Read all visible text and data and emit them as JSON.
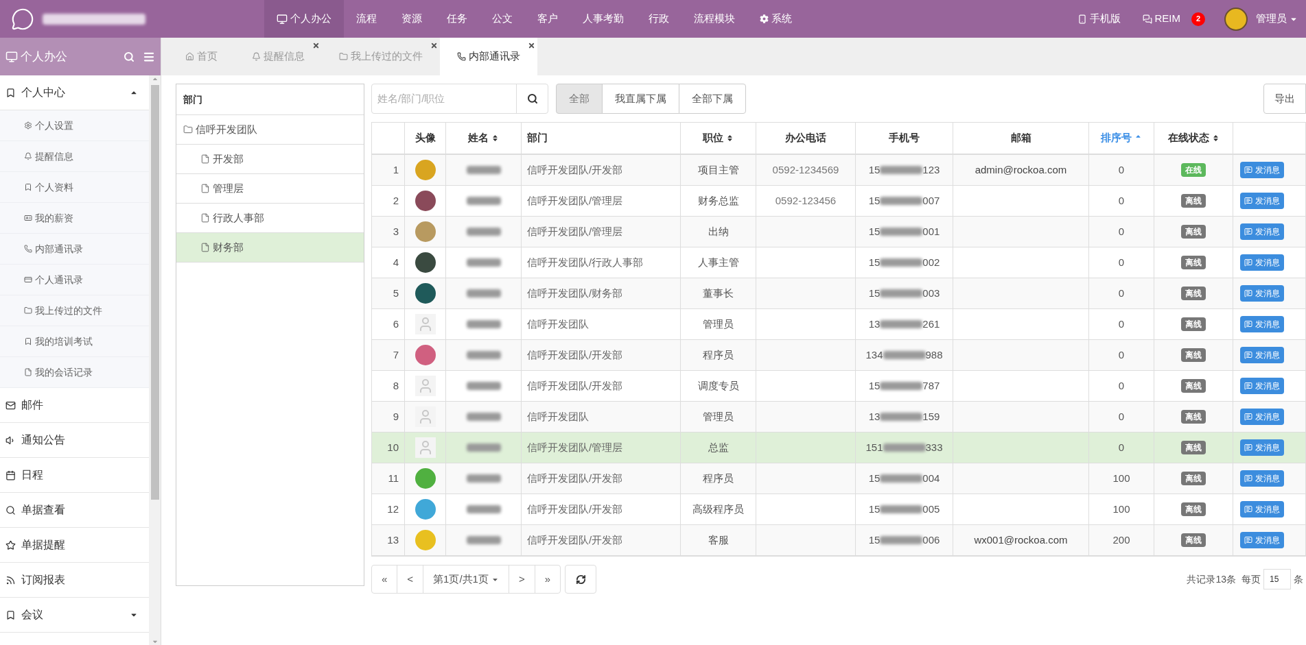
{
  "header": {
    "nav": [
      {
        "label": "个人办公",
        "selected": true
      },
      {
        "label": "流程",
        "selected": false
      },
      {
        "label": "资源",
        "selected": false
      },
      {
        "label": "任务",
        "selected": false
      },
      {
        "label": "公文",
        "selected": false
      },
      {
        "label": "客户",
        "selected": false
      },
      {
        "label": "人事考勤",
        "selected": false
      },
      {
        "label": "行政",
        "selected": false
      },
      {
        "label": "流程模块",
        "selected": false
      },
      {
        "label": "系统",
        "selected": false
      }
    ],
    "mobile": "手机版",
    "chat": "REIM",
    "chat_badge": "2",
    "user": "管理员"
  },
  "sidebar": {
    "title": "个人办公",
    "items": [
      {
        "label": "个人中心",
        "expanded": true,
        "children": [
          {
            "label": "个人设置"
          },
          {
            "label": "提醒信息"
          },
          {
            "label": "个人资料"
          },
          {
            "label": "我的薪资"
          },
          {
            "label": "内部通讯录"
          },
          {
            "label": "个人通讯录"
          },
          {
            "label": "我上传过的文件"
          },
          {
            "label": "我的培训考试"
          },
          {
            "label": "我的会话记录"
          }
        ]
      },
      {
        "label": "邮件"
      },
      {
        "label": "通知公告"
      },
      {
        "label": "日程"
      },
      {
        "label": "单据查看"
      },
      {
        "label": "单据提醒"
      },
      {
        "label": "订阅报表"
      },
      {
        "label": "会议",
        "expanded": false
      }
    ]
  },
  "tabs": [
    {
      "label": "首页",
      "selected": false,
      "closable": false
    },
    {
      "label": "提醒信息",
      "selected": false,
      "closable": true
    },
    {
      "label": "我上传过的文件",
      "selected": false,
      "closable": true
    },
    {
      "label": "内部通讯录",
      "selected": true,
      "closable": true
    }
  ],
  "tree": {
    "heading": "部门",
    "items": [
      {
        "label": "信呼开发团队",
        "selected": false,
        "children": [
          {
            "label": "开发部",
            "selected": false
          },
          {
            "label": "管理层",
            "selected": false
          },
          {
            "label": "行政人事部",
            "selected": false
          },
          {
            "label": "财务部",
            "selected": true
          }
        ]
      }
    ]
  },
  "search": {
    "placeholder": "姓名/部门/职位"
  },
  "filters": [
    {
      "label": "全部",
      "selected": true
    },
    {
      "label": "我直属下属",
      "selected": false
    },
    {
      "label": "全部下属",
      "selected": false
    }
  ],
  "export": "导出",
  "table": {
    "columns": [
      {
        "label": "头像",
        "sortable": false,
        "sorted": false
      },
      {
        "label": "姓名",
        "sortable": true,
        "sorted": false
      },
      {
        "label": "部门",
        "sortable": false,
        "sorted": false
      },
      {
        "label": "职位",
        "sortable": true,
        "sorted": false
      },
      {
        "label": "办公电话",
        "sortable": false,
        "sorted": false
      },
      {
        "label": "手机号",
        "sortable": false,
        "sorted": false
      },
      {
        "label": "邮箱",
        "sortable": false,
        "sorted": false
      },
      {
        "label": "排序号",
        "sortable": true,
        "sorted": true
      },
      {
        "label": "在线状态",
        "sortable": true,
        "sorted": false
      }
    ],
    "rows": [
      {
        "index": "1",
        "avatar": {
          "kind": "photo",
          "color": "#d9a520"
        },
        "dept": "信呼开发团队/开发部",
        "position": "项目主管",
        "office": "0592-1234569",
        "phone_start": "15",
        "phone_end": "123",
        "email": "admin@rockoa.com",
        "order": "0",
        "online": true,
        "status": "在线",
        "action": "发消息",
        "selected": false
      },
      {
        "index": "2",
        "avatar": {
          "kind": "photo",
          "color": "#8a4a5a"
        },
        "dept": "信呼开发团队/管理层",
        "position": "财务总监",
        "office": "0592-123456",
        "phone_start": "15",
        "phone_end": "007",
        "order": "0",
        "online": false,
        "status": "离线",
        "action": "发消息",
        "selected": false
      },
      {
        "index": "3",
        "avatar": {
          "kind": "photo",
          "color": "#b89a60"
        },
        "dept": "信呼开发团队/管理层",
        "position": "出纳",
        "phone_start": "15",
        "phone_end": "001",
        "order": "0",
        "online": false,
        "status": "离线",
        "action": "发消息",
        "selected": false
      },
      {
        "index": "4",
        "avatar": {
          "kind": "photo",
          "color": "#3a4a40"
        },
        "dept": "信呼开发团队/行政人事部",
        "position": "人事主管",
        "phone_start": "15",
        "phone_end": "002",
        "order": "0",
        "online": false,
        "status": "离线",
        "action": "发消息",
        "selected": false
      },
      {
        "index": "5",
        "avatar": {
          "kind": "photo",
          "color": "#1f5a5a"
        },
        "dept": "信呼开发团队/财务部",
        "position": "董事长",
        "phone_start": "15",
        "phone_end": "003",
        "order": "0",
        "online": false,
        "status": "离线",
        "action": "发消息",
        "selected": false
      },
      {
        "index": "6",
        "avatar": {
          "kind": "default"
        },
        "dept": "信呼开发团队",
        "position": "管理员",
        "phone_start": "13",
        "phone_end": "261",
        "order": "0",
        "online": false,
        "status": "离线",
        "action": "发消息",
        "selected": false
      },
      {
        "index": "7",
        "avatar": {
          "kind": "photo",
          "color": "#d06080"
        },
        "dept": "信呼开发团队/开发部",
        "position": "程序员",
        "phone_start": "134",
        "phone_end": "988",
        "order": "0",
        "online": false,
        "status": "离线",
        "action": "发消息",
        "selected": false
      },
      {
        "index": "8",
        "avatar": {
          "kind": "default"
        },
        "dept": "信呼开发团队/开发部",
        "position": "调度专员",
        "phone_start": "15",
        "phone_end": "787",
        "order": "0",
        "online": false,
        "status": "离线",
        "action": "发消息",
        "selected": false
      },
      {
        "index": "9",
        "avatar": {
          "kind": "default"
        },
        "dept": "信呼开发团队",
        "position": "管理员",
        "phone_start": "13",
        "phone_end": "159",
        "order": "0",
        "online": false,
        "status": "离线",
        "action": "发消息",
        "selected": false
      },
      {
        "index": "10",
        "avatar": {
          "kind": "default"
        },
        "dept": "信呼开发团队/管理层",
        "position": "总监",
        "phone_start": "151",
        "phone_end": "333",
        "order": "0",
        "online": false,
        "status": "离线",
        "action": "发消息",
        "selected": true
      },
      {
        "index": "11",
        "avatar": {
          "kind": "photo",
          "color": "#50b040"
        },
        "dept": "信呼开发团队/开发部",
        "position": "程序员",
        "phone_start": "15",
        "phone_end": "004",
        "order": "100",
        "online": false,
        "status": "离线",
        "action": "发消息",
        "selected": false
      },
      {
        "index": "12",
        "avatar": {
          "kind": "photo",
          "color": "#40a8d8"
        },
        "dept": "信呼开发团队/开发部",
        "position": "高级程序员",
        "phone_start": "15",
        "phone_end": "005",
        "order": "100",
        "online": false,
        "status": "离线",
        "action": "发消息",
        "selected": false
      },
      {
        "index": "13",
        "avatar": {
          "kind": "photo",
          "color": "#e8c020"
        },
        "dept": "信呼开发团队/开发部",
        "position": "客服",
        "phone_start": "15",
        "phone_end": "006",
        "email": "wx001@rockoa.com",
        "order": "200",
        "online": false,
        "status": "离线",
        "action": "发消息",
        "selected": false
      }
    ]
  },
  "pager": {
    "first": "«",
    "prev": "<",
    "page": "第1页/共1页",
    "next": ">",
    "last": "»",
    "total": "共记录13条",
    "per_page_label": "每页",
    "per_page": "15",
    "per_page_unit": "条"
  }
}
